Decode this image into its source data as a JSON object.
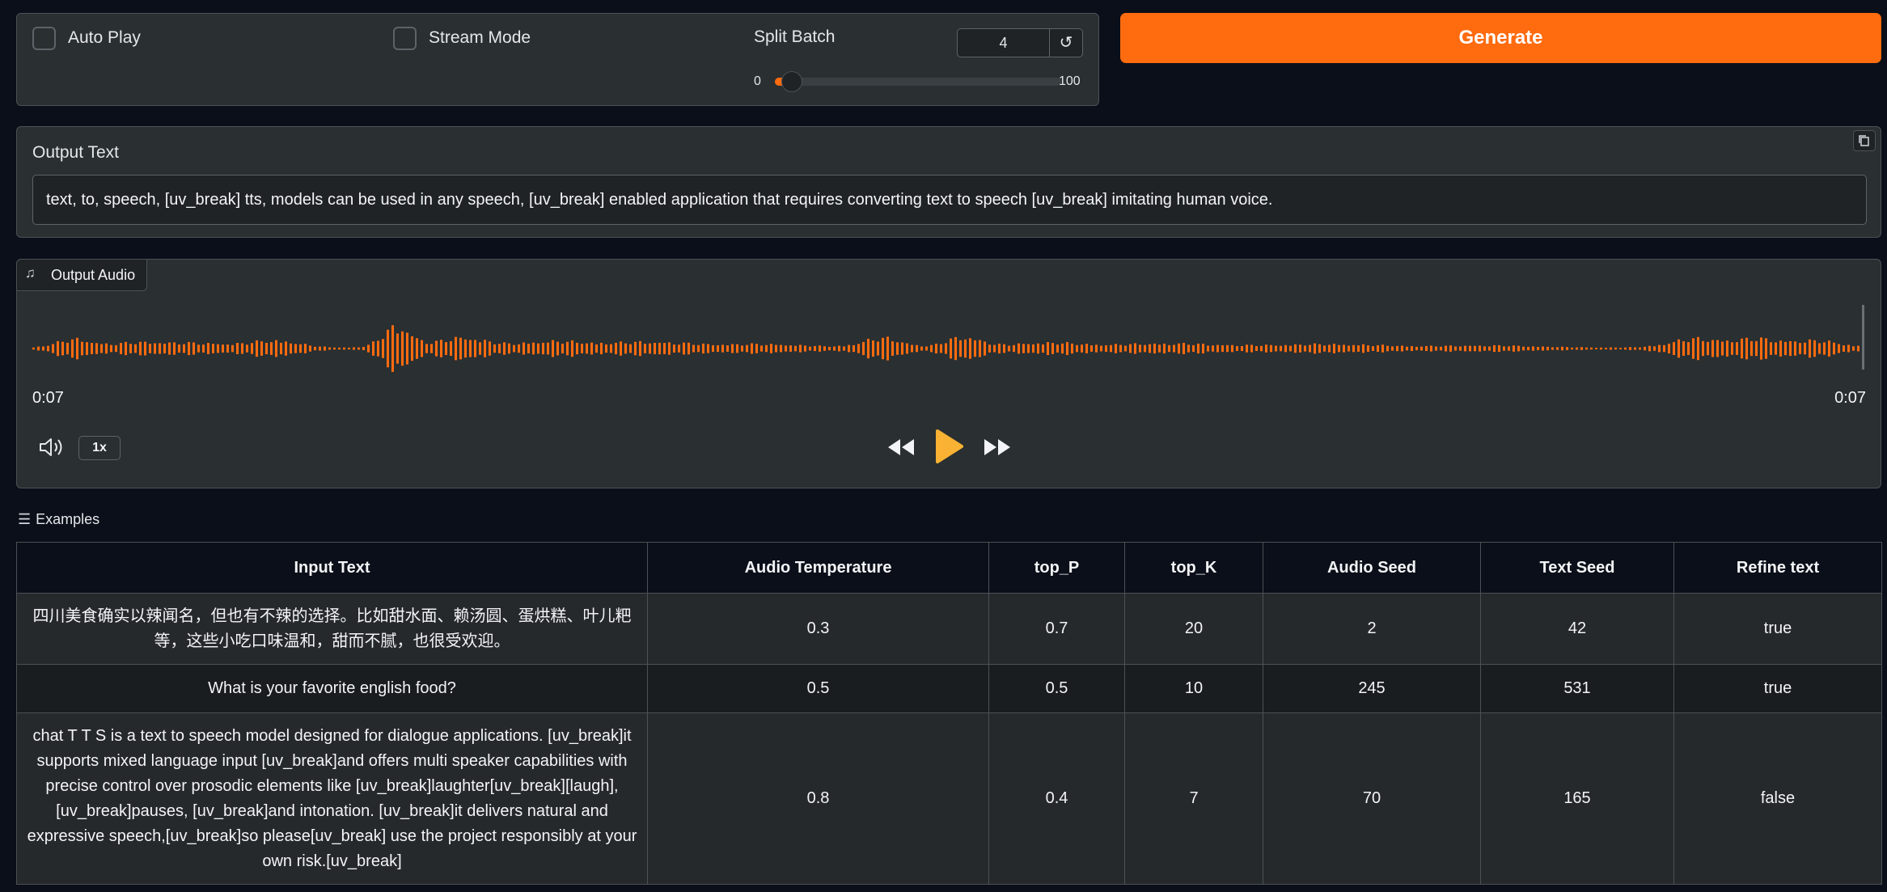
{
  "controls": {
    "auto_play_label": "Auto Play",
    "stream_mode_label": "Stream Mode",
    "split_batch_label": "Split Batch",
    "split_batch_value": "4",
    "reset_icon": "↺",
    "slider_min": "0",
    "slider_max": "100",
    "slider_value_fraction": 0.04
  },
  "generate_label": "Generate",
  "output_text": {
    "label": "Output Text",
    "value": "text, to, speech, [uv_break] tts, models can be used in any speech, [uv_break] enabled application that requires converting text to speech [uv_break] imitating human voice."
  },
  "output_audio": {
    "label": "Output Audio",
    "time_current": "0:07",
    "time_total": "0:07",
    "speed": "1x",
    "waveform_color": "#ff6b0f"
  },
  "examples": {
    "label": "Examples",
    "headers": [
      "Input Text",
      "Audio Temperature",
      "top_P",
      "top_K",
      "Audio Seed",
      "Text Seed",
      "Refine text"
    ],
    "rows": [
      [
        "四川美食确实以辣闻名，但也有不辣的选择。比如甜水面、赖汤圆、蛋烘糕、叶儿粑等，这些小吃口味温和，甜而不腻，也很受欢迎。",
        "0.3",
        "0.7",
        "20",
        "2",
        "42",
        "true"
      ],
      [
        "What is your favorite english food?",
        "0.5",
        "0.5",
        "10",
        "245",
        "531",
        "true"
      ],
      [
        "chat T T S is a text to speech model designed for dialogue applications. [uv_break]it supports mixed language input [uv_break]and offers multi speaker capabilities with precise control over prosodic elements like [uv_break]laughter[uv_break][laugh], [uv_break]pauses, [uv_break]and intonation. [uv_break]it delivers natural and expressive speech,[uv_break]so please[uv_break] use the project responsibly at your own risk.[uv_break]",
        "0.8",
        "0.4",
        "7",
        "70",
        "165",
        "false"
      ]
    ]
  },
  "colors": {
    "accent": "#ff6b0f",
    "play": "#f9b233",
    "background": "#0b0f19",
    "panel": "#2a2f31"
  }
}
